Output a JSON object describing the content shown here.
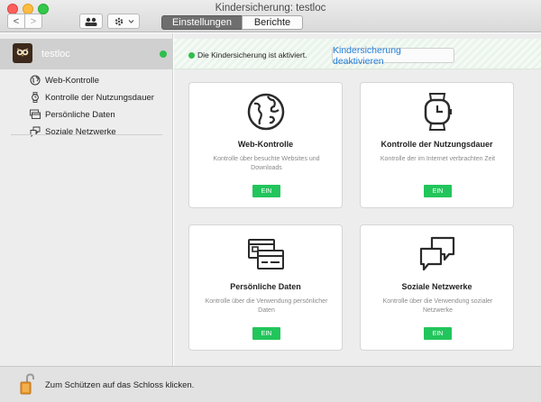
{
  "window": {
    "title": "Kindersicherung: testloc"
  },
  "toolbar": {
    "back_label": "<",
    "forward_label": ">",
    "users_icon": "users-icon",
    "gear_icon": "gear-icon",
    "tabs": [
      {
        "label": "Einstellungen",
        "active": true
      },
      {
        "label": "Berichte",
        "active": false
      }
    ]
  },
  "sidebar": {
    "user": {
      "name": "testloc",
      "online": true,
      "avatar_icon": "owl-avatar-icon"
    },
    "items": [
      {
        "label": "Web-Kontrolle",
        "icon": "globe-icon"
      },
      {
        "label": "Kontrolle der Nutzungsdauer",
        "icon": "watch-icon"
      },
      {
        "label": "Persönliche Daten",
        "icon": "card-icon"
      },
      {
        "label": "Soziale Netzwerke",
        "icon": "chat-bubbles-icon"
      }
    ]
  },
  "status": {
    "text": "Die Kindersicherung ist aktiviert.",
    "deactivate_label": "Kindersicherung deaktivieren",
    "color": "#2fbe4e"
  },
  "cards": [
    {
      "title": "Web-Kontrolle",
      "desc": "Kontrolle über besuchte Websites und Downloads",
      "button": "EIN",
      "icon": "globe-icon"
    },
    {
      "title": "Kontrolle der Nutzungsdauer",
      "desc": "Kontrolle der im Internet verbrachten Zeit",
      "button": "EIN",
      "icon": "watch-icon"
    },
    {
      "title": "Persönliche Daten",
      "desc": "Kontrolle über die Verwendung persönlicher Daten",
      "button": "EIN",
      "icon": "card-icon"
    },
    {
      "title": "Soziale Netzwerke",
      "desc": "Kontrolle über die Verwendung sozialer Netzwerke",
      "button": "EIN",
      "icon": "chat-bubbles-icon"
    }
  ],
  "footer": {
    "text": "Zum Schützen auf das Schloss klicken.",
    "lock_icon": "lock-open-icon"
  },
  "colors": {
    "accent_green": "#22c55b",
    "link_blue": "#1e7fd8"
  }
}
